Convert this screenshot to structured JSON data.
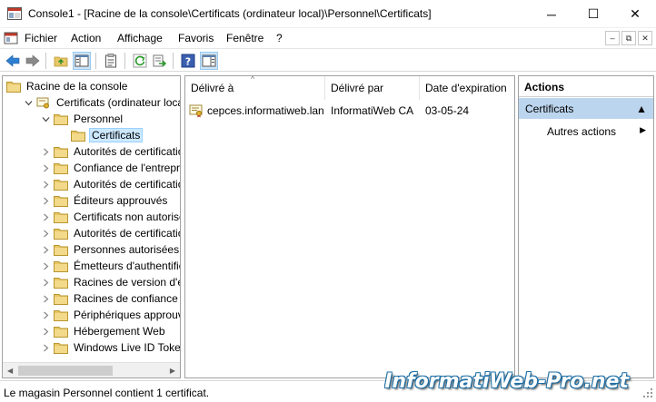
{
  "window": {
    "title": "Console1 - [Racine de la console\\Certificats (ordinateur local)\\Personnel\\Certificats]",
    "minimize_glyph": "─",
    "maximize_glyph": "☐",
    "close_glyph": "✕"
  },
  "menu": {
    "items": [
      "Fichier",
      "Action",
      "Affichage",
      "Favoris",
      "Fenêtre",
      "?"
    ],
    "mdi_min": "–",
    "mdi_restore": "⧉",
    "mdi_close": "✕"
  },
  "toolbar": {
    "buttons": [
      "back-icon",
      "forward-icon",
      "up-folder-icon",
      "show-hide-tree-icon",
      "properties-icon",
      "refresh-icon",
      "export-list-icon",
      "help-icon",
      "show-hide-action-pane-icon"
    ]
  },
  "tree": {
    "items": [
      {
        "label": "Racine de la console",
        "level": 0,
        "expander": ""
      },
      {
        "label": "Certificats (ordinateur local)",
        "level": 1,
        "expander": "expanded"
      },
      {
        "label": "Personnel",
        "level": 2,
        "expander": "expanded"
      },
      {
        "label": "Certificats",
        "level": 3,
        "expander": "",
        "selected": true
      },
      {
        "label": "Autorités de certification",
        "level": 2,
        "expander": "collapsed"
      },
      {
        "label": "Confiance de l'entreprise",
        "level": 2,
        "expander": "collapsed"
      },
      {
        "label": "Autorités de certification",
        "level": 2,
        "expander": "collapsed"
      },
      {
        "label": "Éditeurs approuvés",
        "level": 2,
        "expander": "collapsed"
      },
      {
        "label": "Certificats non autorisés",
        "level": 2,
        "expander": "collapsed"
      },
      {
        "label": "Autorités de certification",
        "level": 2,
        "expander": "collapsed"
      },
      {
        "label": "Personnes autorisées",
        "level": 2,
        "expander": "collapsed"
      },
      {
        "label": "Émetteurs d'authentificat",
        "level": 2,
        "expander": "collapsed"
      },
      {
        "label": "Racines de version d'éval",
        "level": 2,
        "expander": "collapsed"
      },
      {
        "label": "Racines de confiance de c",
        "level": 2,
        "expander": "collapsed"
      },
      {
        "label": "Périphériques approuvés",
        "level": 2,
        "expander": "collapsed"
      },
      {
        "label": "Hébergement Web",
        "level": 2,
        "expander": "collapsed"
      },
      {
        "label": "Windows Live ID Token Is",
        "level": 2,
        "expander": "collapsed"
      }
    ]
  },
  "list": {
    "columns": [
      "Délivré à",
      "Délivré par",
      "Date d'expiration"
    ],
    "sort_glyph": "^",
    "rows": [
      {
        "issued_to": "cepces.informatiweb.lan",
        "issued_by": "InformatiWeb CA",
        "expiration": "03-05-24"
      }
    ]
  },
  "actions": {
    "header": "Actions",
    "section": "Certificats",
    "section_glyph": "▲",
    "item": "Autres actions",
    "item_glyph": "▶"
  },
  "status": {
    "text": "Le magasin Personnel contient 1 certificat.",
    "watermark": "InformatiWeb-Pro.net"
  },
  "colors": {
    "selection": "#cce8ff",
    "actions_section": "#bcd5ee",
    "folder": "#e8c766",
    "accent": "#1d6fa5"
  }
}
